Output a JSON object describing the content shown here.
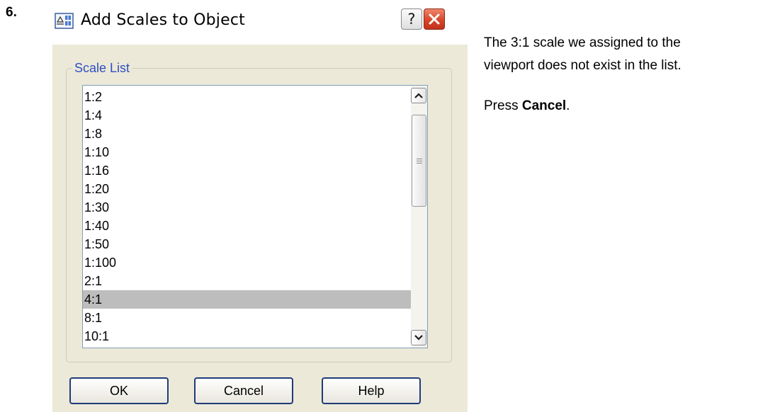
{
  "step_number": "6.",
  "dialog": {
    "title": "Add Scales to Object",
    "titlebar_buttons": {
      "help_label": "?",
      "close_icon": "close-icon"
    },
    "group_label": "Scale List",
    "scale_list": [
      {
        "label": "1:2",
        "selected": false
      },
      {
        "label": "1:4",
        "selected": false
      },
      {
        "label": "1:8",
        "selected": false
      },
      {
        "label": "1:10",
        "selected": false
      },
      {
        "label": "1:16",
        "selected": false
      },
      {
        "label": "1:20",
        "selected": false
      },
      {
        "label": "1:30",
        "selected": false
      },
      {
        "label": "1:40",
        "selected": false
      },
      {
        "label": "1:50",
        "selected": false
      },
      {
        "label": "1:100",
        "selected": false
      },
      {
        "label": "2:1",
        "selected": false
      },
      {
        "label": "4:1",
        "selected": true
      },
      {
        "label": "8:1",
        "selected": false
      },
      {
        "label": "10:1",
        "selected": false
      }
    ],
    "buttons": {
      "ok": "OK",
      "cancel": "Cancel",
      "help": "Help"
    }
  },
  "instructions": {
    "line1": "The 3:1 scale we assigned to the",
    "line2": "viewport does not exist in the list.",
    "press_prefix": "Press ",
    "press_bold": "Cancel",
    "press_suffix": "."
  },
  "colors": {
    "dialog_bg": "#ece9d8",
    "group_label": "#2f4fc0",
    "selected_row": "#bdbdbd",
    "button_border": "#1f3c7a",
    "close_button": "#d8452a"
  }
}
